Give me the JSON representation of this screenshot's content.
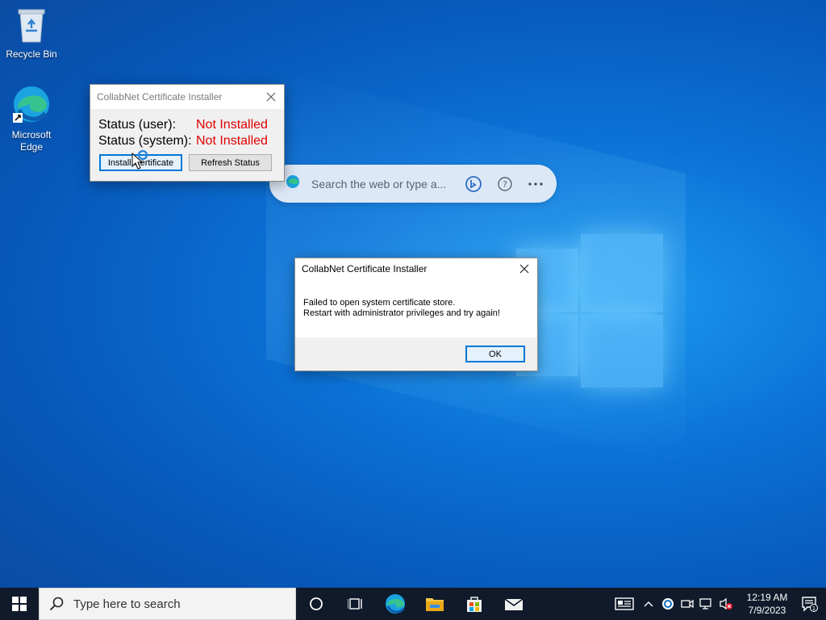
{
  "desktop": {
    "icons": [
      {
        "label": "Recycle Bin",
        "icon": "recycle-bin-icon"
      },
      {
        "label": "Microsoft Edge",
        "icon": "edge-icon"
      }
    ]
  },
  "search_bubble": {
    "placeholder": "Search the web or type a..."
  },
  "main_window": {
    "title": "CollabNet Certificate Installer",
    "status_user_label": "Status (user):",
    "status_user_value": "Not Installed",
    "status_system_label": "Status (system):",
    "status_system_value": "Not Installed",
    "install_button": "Install Certificate",
    "refresh_button": "Refresh Status",
    "status_color": "#e00000"
  },
  "message_box": {
    "title": "CollabNet Certificate Installer",
    "line1": "Failed to open system certificate store.",
    "line2": "Restart with administrator privileges and try again!",
    "ok_button": "OK"
  },
  "taskbar": {
    "search_placeholder": "Type here to search",
    "pinned": [
      "cortana-icon",
      "task-view-icon",
      "edge-icon",
      "file-explorer-icon",
      "store-icon",
      "mail-icon"
    ],
    "clock_time": "12:19 AM",
    "clock_date": "7/9/2023",
    "notification_count": "1"
  },
  "colors": {
    "accent": "#0078d7",
    "error_text": "#e00000",
    "taskbar_bg": "#101a2a"
  }
}
